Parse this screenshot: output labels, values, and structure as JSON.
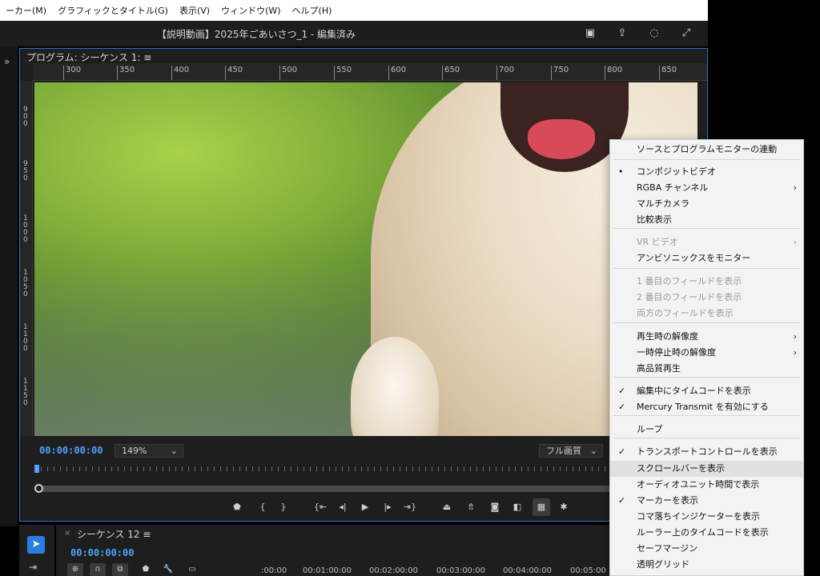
{
  "menubar": {
    "items": [
      "ーカー(M)",
      "グラフィックとタイトル(G)",
      "表示(V)",
      "ウィンドウ(W)",
      "ヘルプ(H)"
    ]
  },
  "titlebar": {
    "title": "【説明動画】2025年ごあいさつ_1 - 編集済み"
  },
  "panel": {
    "title": "プログラム: シーケンス 1: ≡",
    "ruler_marks": [
      "300",
      "350",
      "400",
      "450",
      "500",
      "550",
      "600",
      "650",
      "700",
      "750",
      "800",
      "850"
    ],
    "vruler_marks": [
      "900",
      "950",
      "1000",
      "1050",
      "1100",
      "1150"
    ],
    "timecode": "00:00:00:00",
    "zoom": "149%",
    "quality": "フル画質"
  },
  "timeline": {
    "title": "シーケンス 12 ≡",
    "timecode": "00:00:00:00",
    "times": [
      ":00:00",
      "00:01:00:00",
      "00:02:00:00",
      "00:03:00:00",
      "00:04:00:00",
      "00:05:00"
    ]
  },
  "context_menu": {
    "items": [
      {
        "label": "ソースとプログラムモニターの連動",
        "check": "",
        "arrow": false,
        "disabled": false,
        "hover": false
      },
      {
        "label": "コンポジットビデオ",
        "check": "•",
        "arrow": false,
        "disabled": false,
        "hover": false
      },
      {
        "label": "RGBA チャンネル",
        "check": "",
        "arrow": true,
        "disabled": false,
        "hover": false
      },
      {
        "label": "マルチカメラ",
        "check": "",
        "arrow": false,
        "disabled": false,
        "hover": false
      },
      {
        "label": "比較表示",
        "check": "",
        "arrow": false,
        "disabled": false,
        "hover": false
      },
      {
        "label": "VR ビデオ",
        "check": "",
        "arrow": true,
        "disabled": true,
        "hover": false
      },
      {
        "label": "アンビソニックスをモニター",
        "check": "",
        "arrow": false,
        "disabled": false,
        "hover": false
      },
      {
        "label": "1 番目のフィールドを表示",
        "check": "",
        "arrow": false,
        "disabled": true,
        "hover": false
      },
      {
        "label": "2 番目のフィールドを表示",
        "check": "",
        "arrow": false,
        "disabled": true,
        "hover": false
      },
      {
        "label": "両方のフィールドを表示",
        "check": "",
        "arrow": false,
        "disabled": true,
        "hover": false
      },
      {
        "label": "再生時の解像度",
        "check": "",
        "arrow": true,
        "disabled": false,
        "hover": false
      },
      {
        "label": "一時停止時の解像度",
        "check": "",
        "arrow": true,
        "disabled": false,
        "hover": false
      },
      {
        "label": "高品質再生",
        "check": "",
        "arrow": false,
        "disabled": false,
        "hover": false
      },
      {
        "label": "編集中にタイムコードを表示",
        "check": "✓",
        "arrow": false,
        "disabled": false,
        "hover": false
      },
      {
        "label": "Mercury Transmit を有効にする",
        "check": "✓",
        "arrow": false,
        "disabled": false,
        "hover": false
      },
      {
        "label": "ループ",
        "check": "",
        "arrow": false,
        "disabled": false,
        "hover": false
      },
      {
        "label": "トランスポートコントロールを表示",
        "check": "✓",
        "arrow": false,
        "disabled": false,
        "hover": false
      },
      {
        "label": "スクロールバーを表示",
        "check": "",
        "arrow": false,
        "disabled": false,
        "hover": true
      },
      {
        "label": "オーディオユニット時間で表示",
        "check": "",
        "arrow": false,
        "disabled": false,
        "hover": false
      },
      {
        "label": "マーカーを表示",
        "check": "✓",
        "arrow": false,
        "disabled": false,
        "hover": false
      },
      {
        "label": "コマ落ちインジケーターを表示",
        "check": "",
        "arrow": false,
        "disabled": false,
        "hover": false
      },
      {
        "label": "ルーラー上のタイムコードを表示",
        "check": "",
        "arrow": false,
        "disabled": false,
        "hover": false
      },
      {
        "label": "セーフマージン",
        "check": "",
        "arrow": false,
        "disabled": false,
        "hover": false
      },
      {
        "label": "透明グリッド",
        "check": "",
        "arrow": false,
        "disabled": false,
        "hover": false
      }
    ]
  },
  "colors": {
    "accent": "#2d6fd6",
    "timecode": "#4fa3ff",
    "menu_bg": "#f3f3f3"
  }
}
